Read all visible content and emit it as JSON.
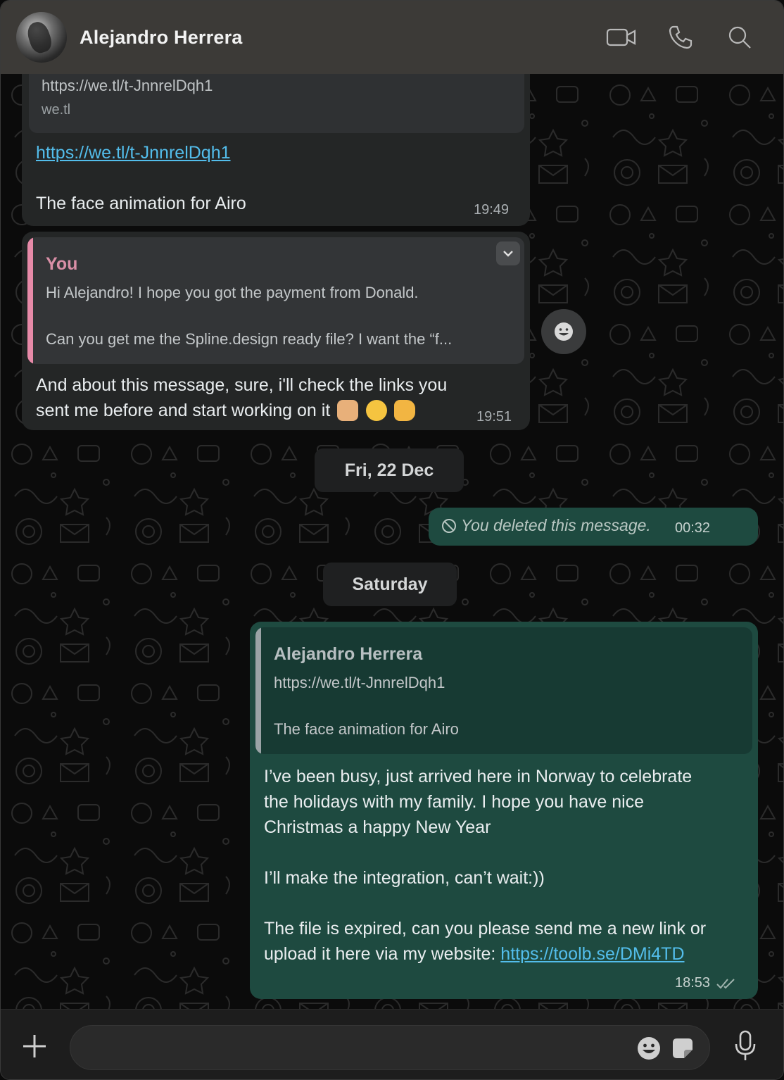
{
  "header": {
    "contact_name": "Alejandro Herrera",
    "actions": [
      "video-call",
      "voice-call",
      "search"
    ]
  },
  "messages": {
    "m1": {
      "preview_url": "https://we.tl/t-JnnrelDqh1",
      "preview_domain": "we.tl",
      "link": "https://we.tl/t-JnnrelDqh1",
      "text": "The face animation for Airo",
      "time": "19:49"
    },
    "m2": {
      "quote_author": "You",
      "quote_line1": "Hi Alejandro! I hope you got the payment from Donald.",
      "quote_line2": "Can you get me the Spline.design ready file? I want the “f...",
      "text_line1": "And about this message, sure, i'll check the links you",
      "text_line2": "sent me before and start working on it",
      "emojis": [
        "raising-hands",
        "partying-face",
        "pointing-hand"
      ],
      "time": "19:51"
    },
    "date1": "Fri, 22 Dec",
    "m3": {
      "text": "You deleted this message.",
      "time": "00:32"
    },
    "date2": "Saturday",
    "m4": {
      "quote_author": "Alejandro Herrera",
      "quote_line1": "https://we.tl/t-JnnrelDqh1",
      "quote_line2": "The face animation for Airo",
      "p1_l1": "I’ve been busy, just arrived here in Norway to celebrate",
      "p1_l2": "the holidays with my family. I hope you have nice",
      "p1_l3": "Christmas a happy New Year",
      "p2": "I’ll make the integration, can’t wait:))",
      "p3_l1": "The file is expired, can you please send me a new link or",
      "p3_l2": "upload it here via my website:",
      "p3_link": "https://toolb.se/DMi4TD",
      "time": "18:53",
      "status": "read"
    }
  },
  "composer": {
    "placeholder": "",
    "value": ""
  },
  "colors": {
    "incoming_bubble": "#242626",
    "outgoing_bubble": "#1e4a40",
    "link": "#53bdeb",
    "you_author": "#d98fa6",
    "quote_bar_you": "#e78aa8",
    "quote_bar_contact": "#9aa3a6"
  }
}
